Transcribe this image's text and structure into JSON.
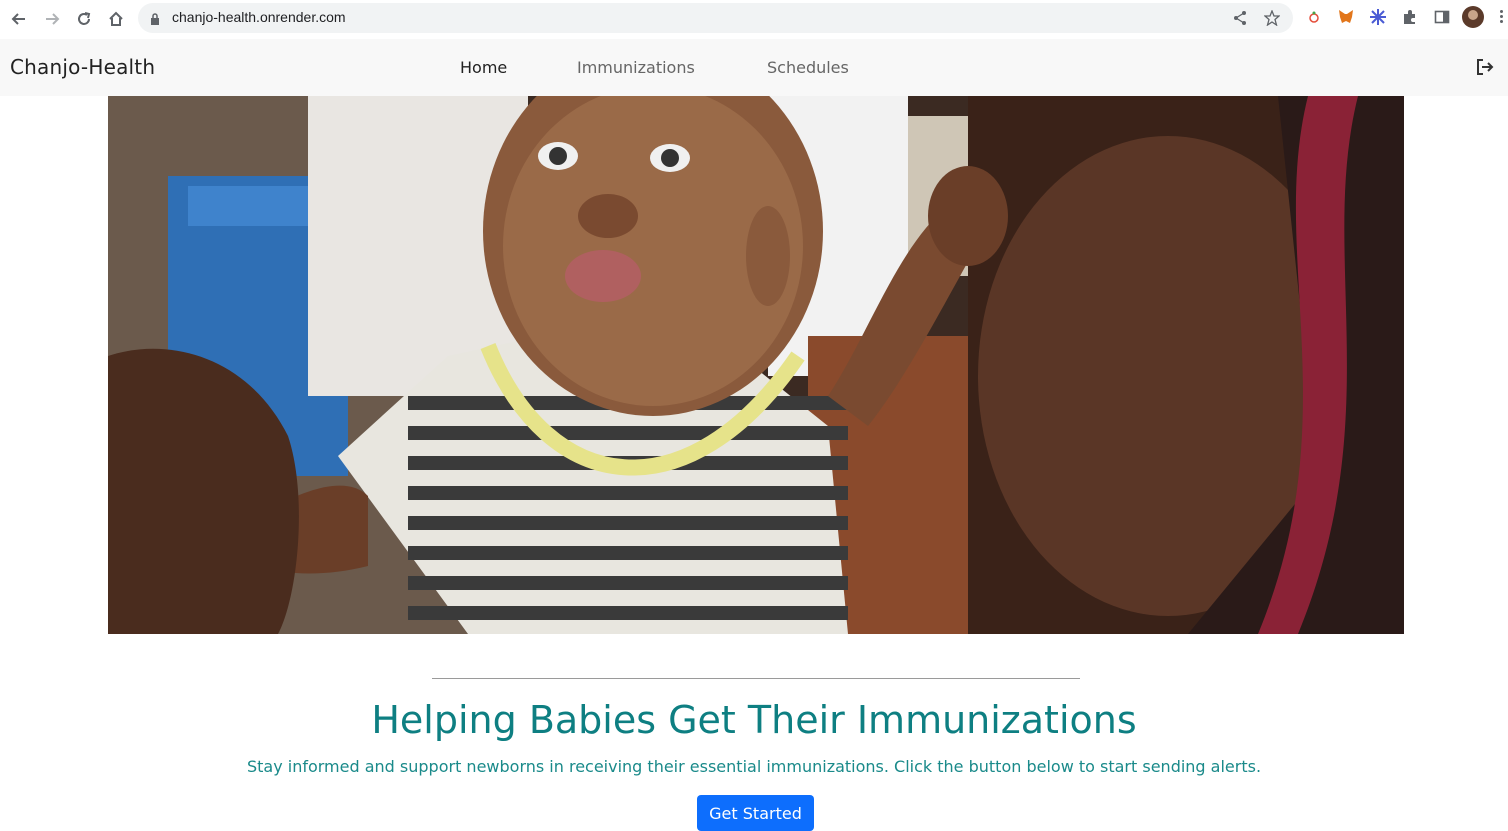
{
  "browser": {
    "url": "chanjo-health.onrender.com"
  },
  "navbar": {
    "brand": "Chanjo-Health",
    "links": [
      {
        "label": "Home",
        "active": true
      },
      {
        "label": "Immunizations",
        "active": false
      },
      {
        "label": "Schedules",
        "active": false
      }
    ]
  },
  "hero": {
    "headline": "Helping Babies Get Their Immunizations",
    "subtext": "Stay informed and support newborns in receiving their essential immunizations. Click the button below to start sending alerts.",
    "cta_label": "Get Started"
  },
  "colors": {
    "accent_teal": "#0e7f82",
    "button_blue": "#0d6efd",
    "navbar_bg": "#f8f8f8"
  }
}
